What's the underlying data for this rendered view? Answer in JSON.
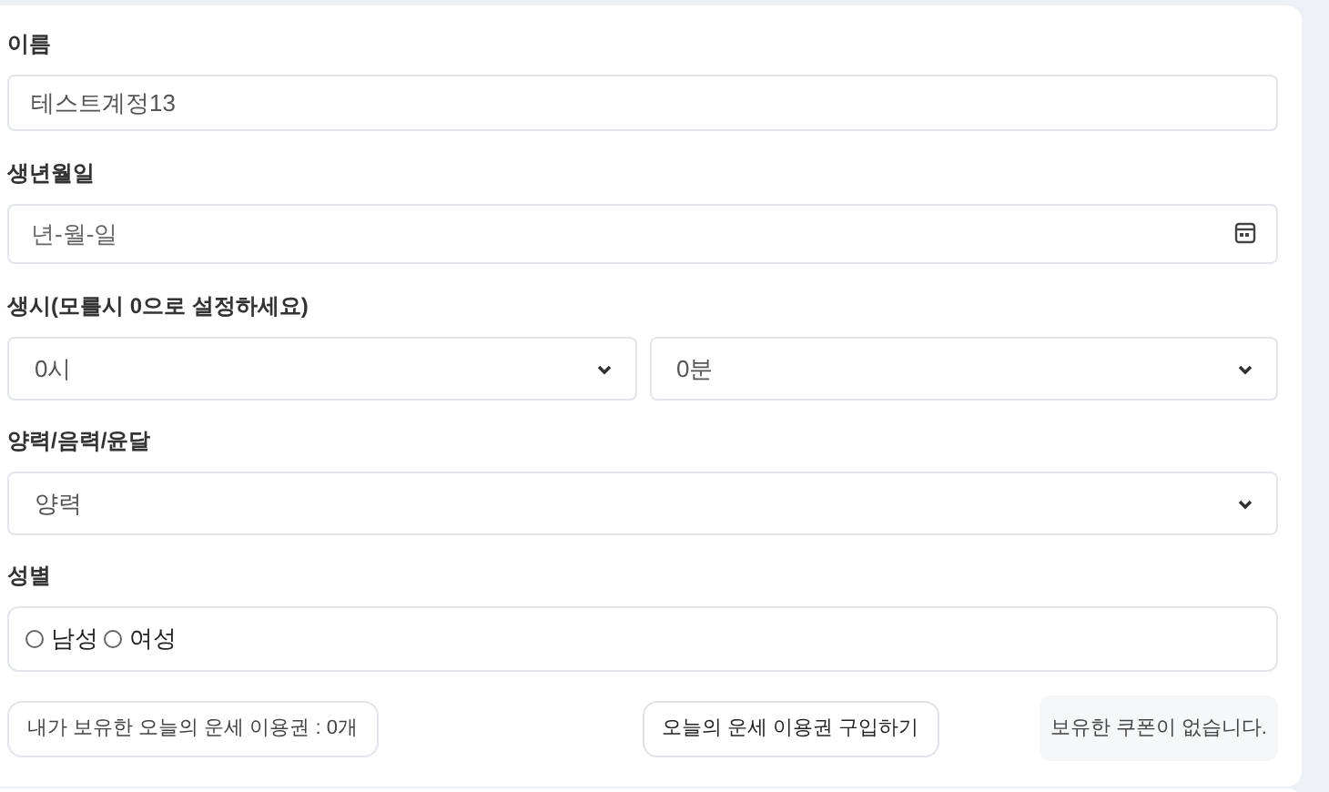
{
  "name": {
    "label": "이름",
    "value": "테스트계정13"
  },
  "birthdate": {
    "label": "생년월일",
    "placeholder": "년-월-일"
  },
  "birth_time": {
    "label": "생시(모를시 0으로 설정하세요)",
    "hour": "0시",
    "minute": "0분"
  },
  "calendar": {
    "label": "양력/음력/윤달",
    "value": "양력"
  },
  "gender": {
    "label": "성별",
    "options": [
      {
        "label": "남성",
        "selected": false
      },
      {
        "label": "여성",
        "selected": false
      }
    ]
  },
  "ticket_count": "내가 보유한 오늘의 운세 이용권 : 0개",
  "buy_button": "오늘의 운세 이용권 구입하기",
  "coupon_message": "보유한 쿠폰이 없습니다."
}
